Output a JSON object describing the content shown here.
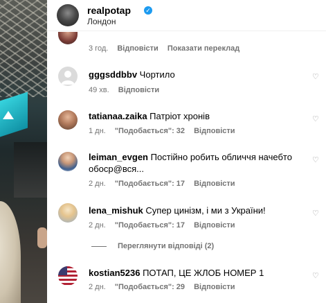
{
  "header": {
    "username": "realpotap",
    "location": "Лондон"
  },
  "first_meta": {
    "time": "3 год.",
    "reply": "Відповісти",
    "translate": "Показати переклад"
  },
  "comments": [
    {
      "username": "gggsddbbv",
      "text": "Чортило",
      "time": "49 хв.",
      "likes": "",
      "reply": "Відповісти"
    },
    {
      "username": "tatianaa.zaika",
      "text": "Патріот хронів",
      "time": "1 дн.",
      "likes": "\"Подобається\": 32",
      "reply": "Відповісти"
    },
    {
      "username": "leiman_evgen",
      "text": "Постійно робить обличчя начебто обоср@вся...",
      "time": "2 дн.",
      "likes": "\"Подобається\": 17",
      "reply": "Відповісти"
    },
    {
      "username": "lena_mishuk",
      "text": "Супер цинізм, і ми з України!",
      "time": "2 дн.",
      "likes": "\"Подобається\": 17",
      "reply": "Відповісти"
    },
    {
      "username": "kostian5236",
      "text": "ПОТАП, ЦЕ ЖЛОБ НОМЕР 1",
      "time": "2 дн.",
      "likes": "\"Подобається\": 29",
      "reply": "Відповісти"
    }
  ],
  "view_replies": "Переглянути відповіді (2)"
}
